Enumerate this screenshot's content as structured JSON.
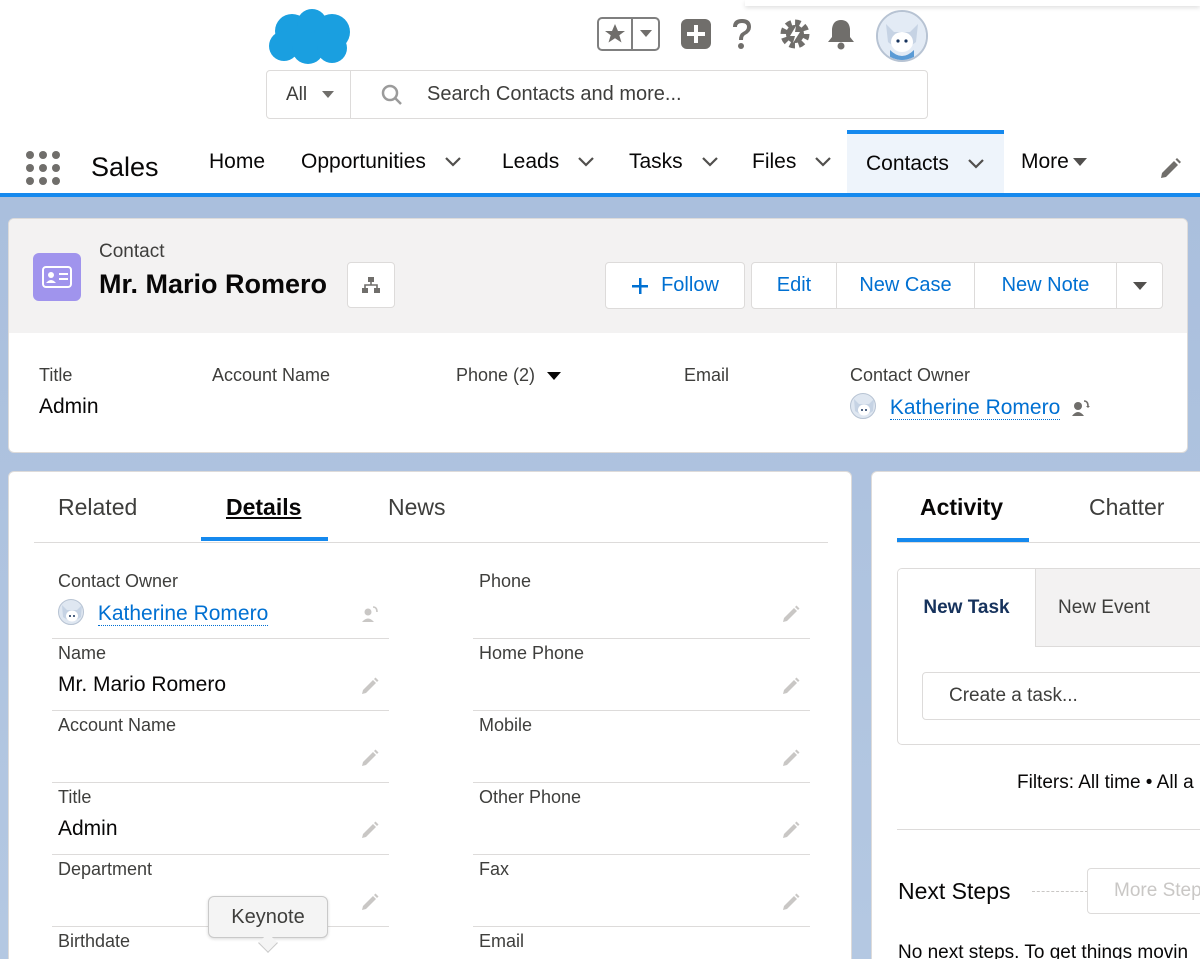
{
  "header": {
    "search_scope": "All",
    "search_placeholder": "Search Contacts and more..."
  },
  "nav": {
    "app_name": "Sales",
    "items": [
      {
        "label": "Home"
      },
      {
        "label": "Opportunities"
      },
      {
        "label": "Leads"
      },
      {
        "label": "Tasks"
      },
      {
        "label": "Files"
      },
      {
        "label": "Contacts",
        "active": true
      },
      {
        "label": "More"
      }
    ]
  },
  "record": {
    "object_type": "Contact",
    "name": "Mr. Mario Romero",
    "actions": {
      "follow": "Follow",
      "edit": "Edit",
      "new_case": "New Case",
      "new_note": "New Note"
    },
    "highlights": {
      "title_label": "Title",
      "title_value": "Admin",
      "account_label": "Account Name",
      "phone_label": "Phone (2)",
      "email_label": "Email",
      "owner_label": "Contact Owner",
      "owner_value": "Katherine Romero"
    }
  },
  "details": {
    "tabs": [
      "Related",
      "Details",
      "News"
    ],
    "active_tab": "Details",
    "left_fields": [
      {
        "label": "Contact Owner",
        "value": "Katherine Romero"
      },
      {
        "label": "Name",
        "value": "Mr. Mario Romero"
      },
      {
        "label": "Account Name",
        "value": ""
      },
      {
        "label": "Title",
        "value": "Admin"
      },
      {
        "label": "Department",
        "value": ""
      },
      {
        "label": "Birthdate",
        "value": ""
      }
    ],
    "right_fields": [
      {
        "label": "Phone",
        "value": ""
      },
      {
        "label": "Home Phone",
        "value": ""
      },
      {
        "label": "Mobile",
        "value": ""
      },
      {
        "label": "Other Phone",
        "value": ""
      },
      {
        "label": "Fax",
        "value": ""
      },
      {
        "label": "Email",
        "value": ""
      }
    ],
    "tooltip": "Keynote"
  },
  "activity": {
    "tabs": [
      "Activity",
      "Chatter"
    ],
    "composer_tabs": [
      "New Task",
      "New Event"
    ],
    "task_placeholder": "Create a task...",
    "filters": "Filters: All time • All a",
    "next_steps_title": "Next Steps",
    "more_steps": "More Step",
    "no_steps": "No next steps. To get things movin"
  },
  "colors": {
    "brand_blue": "#1589ee",
    "link_blue": "#0070d2",
    "contact_icon": "#a094ed",
    "cloud_logo": "#1a9fe0"
  }
}
